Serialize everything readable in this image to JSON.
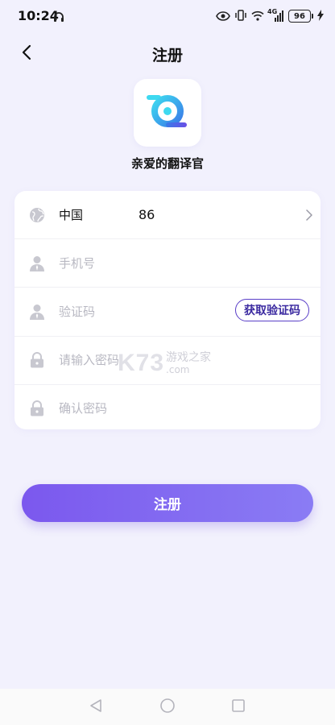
{
  "status_bar": {
    "time": "10:24",
    "network": "4G",
    "battery": "96",
    "icons": [
      "headphones-icon",
      "eye-icon",
      "vibrate-icon",
      "wifi-icon",
      "signal-icon",
      "battery-icon",
      "charging-icon"
    ]
  },
  "header": {
    "title": "注册",
    "back_icon": "chevron-left-icon"
  },
  "app": {
    "name": "亲爱的翻译官",
    "logo_icon": "app-logo-icon"
  },
  "form": {
    "country": {
      "label": "中国",
      "code": "86",
      "icon": "globe-icon"
    },
    "phone": {
      "placeholder": "手机号",
      "value": "",
      "icon": "user-icon"
    },
    "code": {
      "placeholder": "验证码",
      "value": "",
      "icon": "user-icon",
      "button_label": "获取验证码"
    },
    "password": {
      "placeholder": "请输入密码",
      "value": "",
      "icon": "lock-icon"
    },
    "confirm": {
      "placeholder": "确认密码",
      "value": "",
      "icon": "lock-icon"
    }
  },
  "submit_label": "注册",
  "watermark": {
    "brand": "K73",
    "cn": "游戏之家",
    "domain": ".com"
  },
  "colors": {
    "background": "#f2f1fd",
    "accent": "#7b58ee",
    "accent_light": "#8a7cf4",
    "outline": "#5a3fc8",
    "placeholder": "#b8b8c2",
    "icon": "#c8c8d0"
  }
}
